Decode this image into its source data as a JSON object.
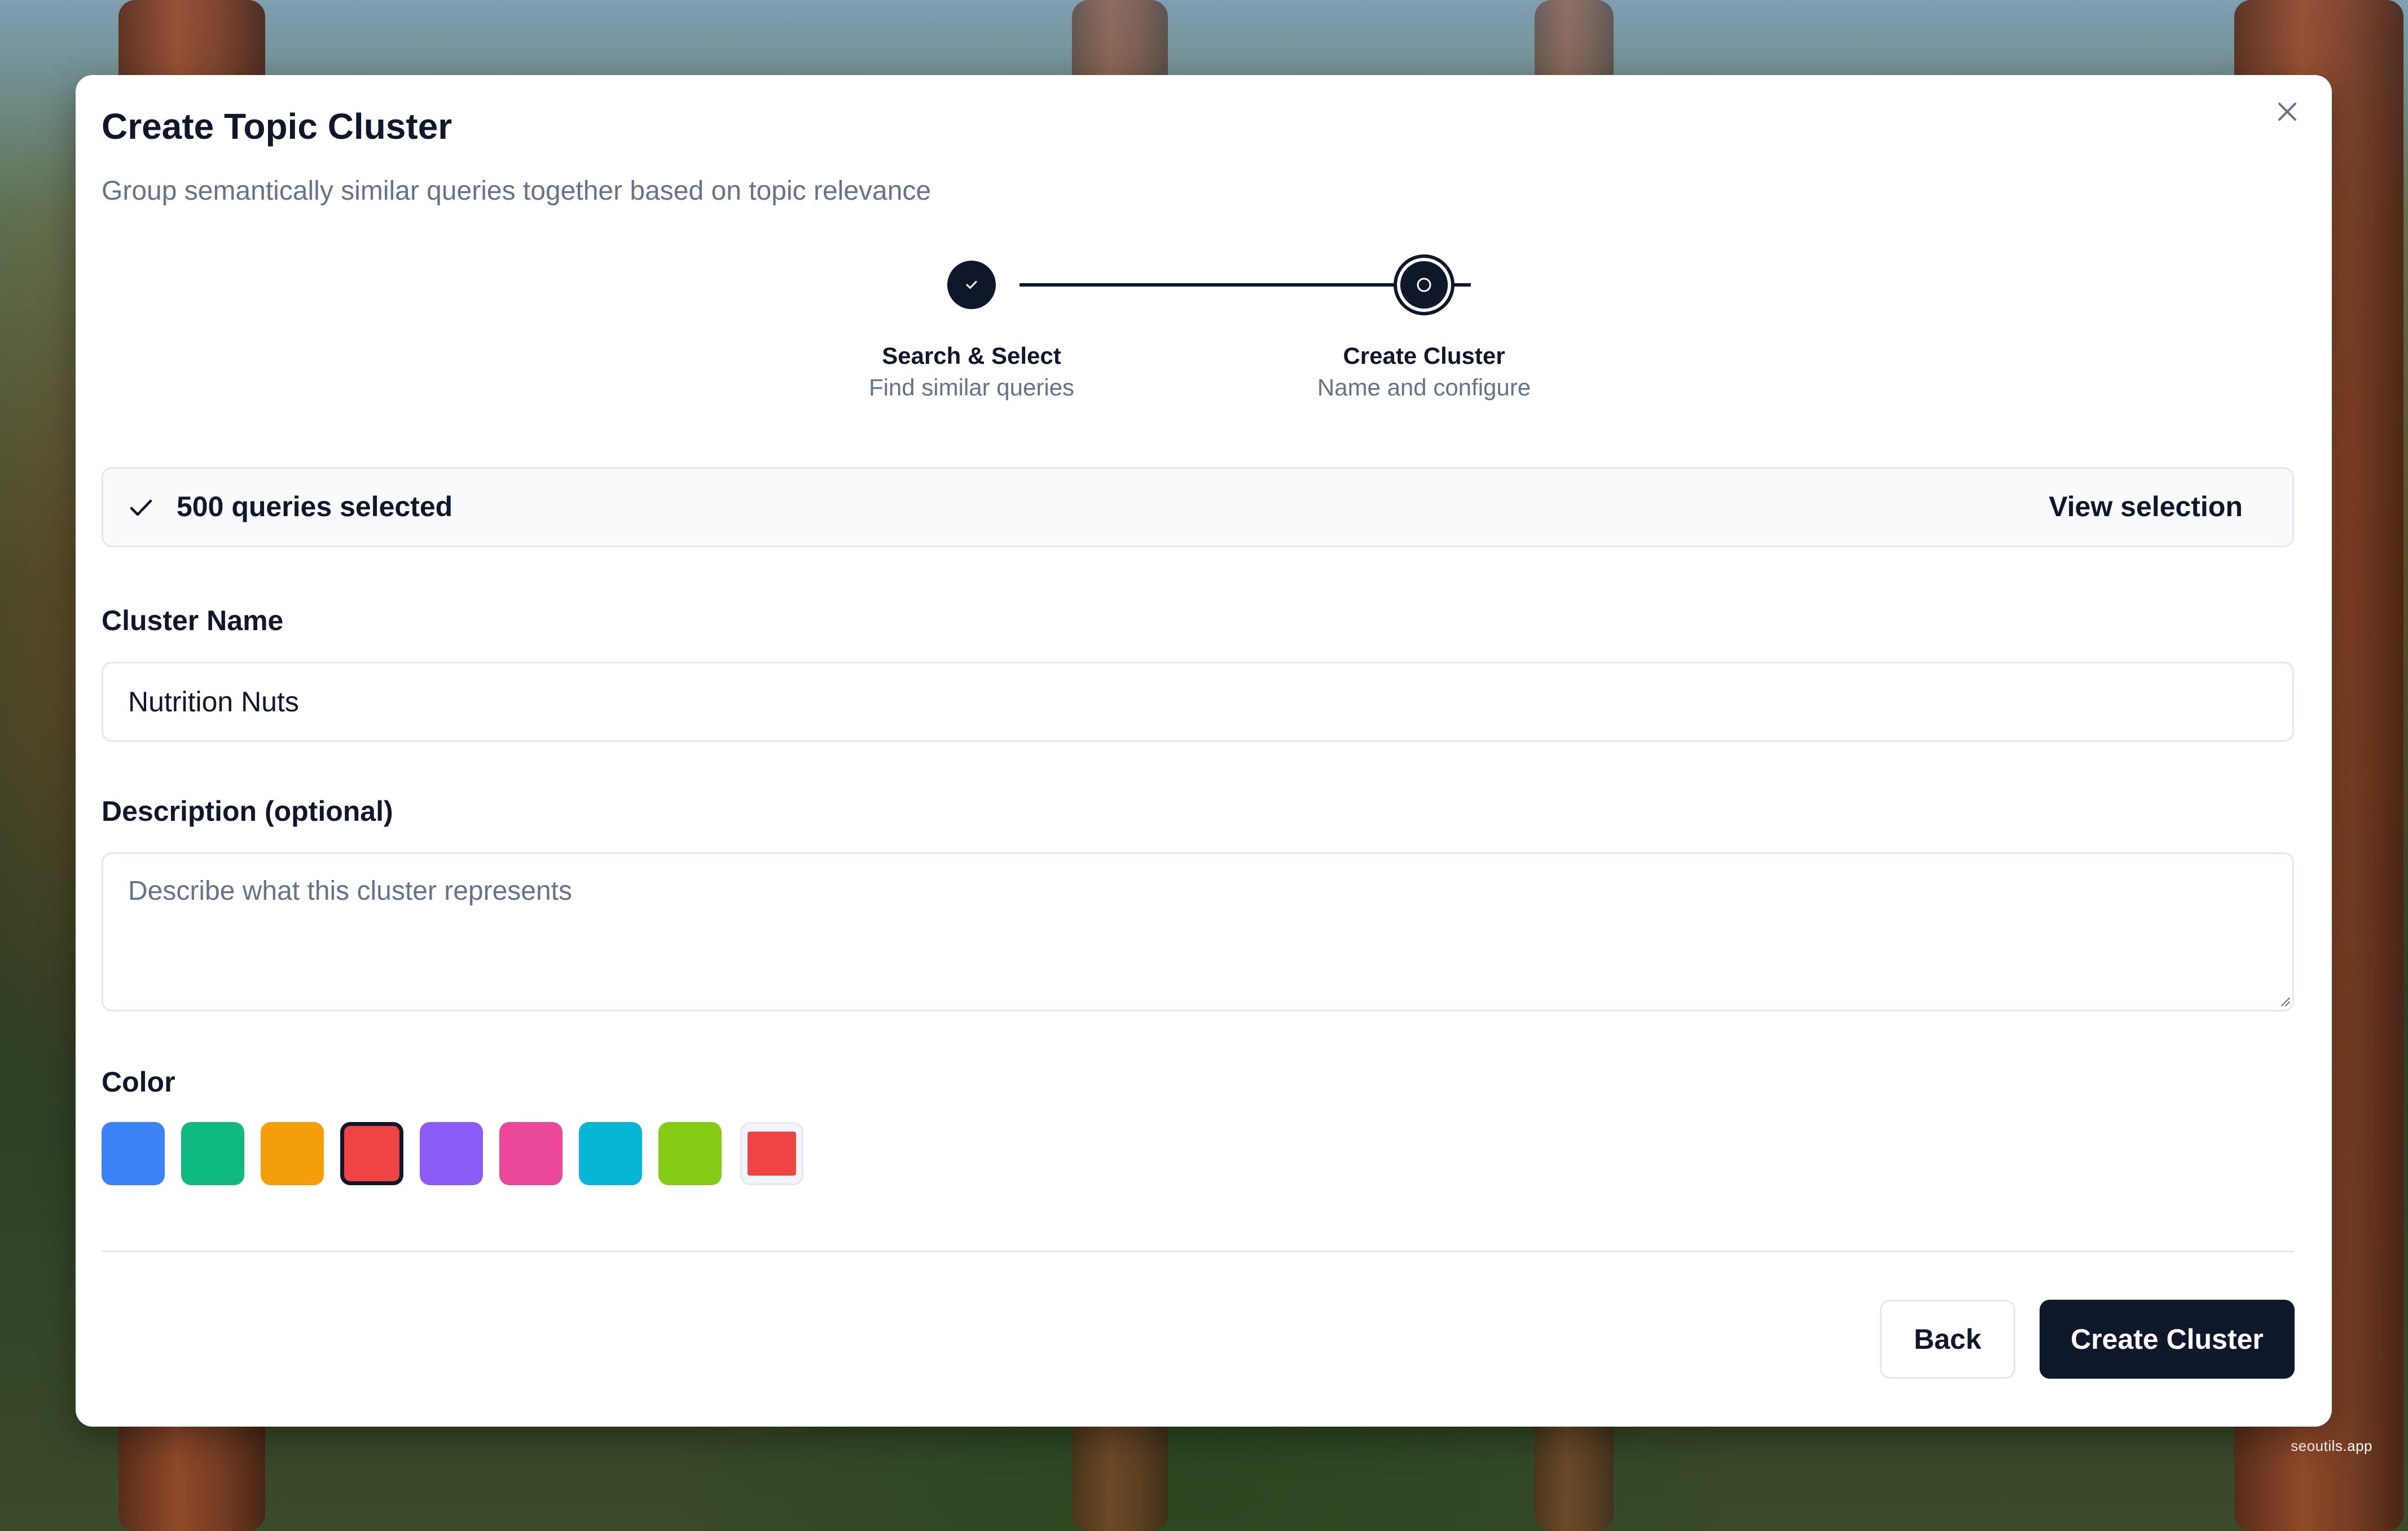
{
  "modal": {
    "title": "Create Topic Cluster",
    "subtitle": "Group semantically similar queries together based on topic relevance"
  },
  "stepper": {
    "steps": [
      {
        "title": "Search & Select",
        "description": "Find similar queries",
        "status": "complete"
      },
      {
        "title": "Create Cluster",
        "description": "Name and configure",
        "status": "current"
      }
    ]
  },
  "selection": {
    "count_label": "500 queries selected",
    "view_label": "View selection"
  },
  "form": {
    "name_label": "Cluster Name",
    "name_value": "Nutrition Nuts",
    "description_label": "Description (optional)",
    "description_placeholder": "Describe what this cluster represents",
    "color_label": "Color",
    "colors": [
      "#3b82f6",
      "#10b981",
      "#f59e0b",
      "#ef4444",
      "#8b5cf6",
      "#ec4899",
      "#06b6d4",
      "#84cc16"
    ],
    "selected_color": "#ef4444",
    "custom_color": "#ef4444"
  },
  "actions": {
    "back_label": "Back",
    "create_label": "Create Cluster"
  },
  "watermark": "seoutils.app",
  "theme": {
    "primary": "#0f172a",
    "muted": "#64748b",
    "border": "#e2e8f0"
  }
}
